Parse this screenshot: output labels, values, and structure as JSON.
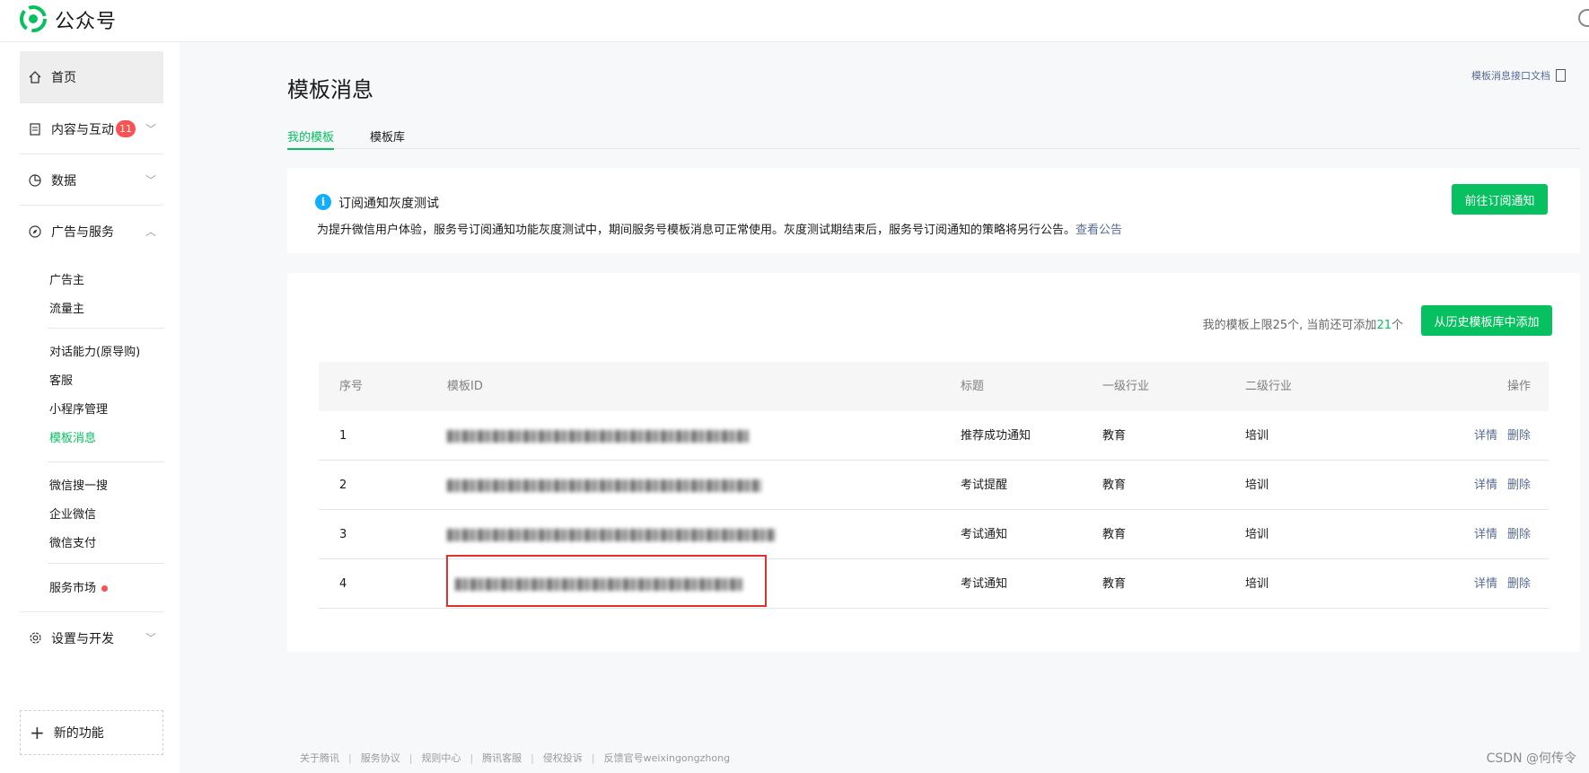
{
  "header": {
    "logo_text": "公众号",
    "logo_color": "#07c160"
  },
  "sidebar": {
    "home": "首页",
    "content": "内容与互动",
    "content_badge": "11",
    "data": "数据",
    "ads": "广告与服务",
    "ads_sub": [
      "广告主",
      "流量主"
    ],
    "capability_sub": [
      "对话能力(原导购)",
      "客服",
      "小程序管理",
      "模板消息"
    ],
    "wechat_sub": [
      "微信搜一搜",
      "企业微信",
      "微信支付"
    ],
    "market": "服务市场",
    "settings": "设置与开发",
    "new_feature": "新的功能"
  },
  "main": {
    "title": "模板消息",
    "doc_link": "模板消息接口文档",
    "tabs": [
      "我的模板",
      "模板库"
    ],
    "notice": {
      "title": "订阅通知灰度测试",
      "body": "为提升微信用户体验，服务号订阅通知功能灰度测试中，期间服务号模板消息可正常使用。灰度测试期结束后，服务号订阅通知的策略将另行公告。",
      "link": "查看公告",
      "button": "前往订阅通知"
    },
    "limit": {
      "prefix": "我的模板上限25个, 当前还可添加",
      "count": "21",
      "suffix": "个"
    },
    "add_button": "从历史模板库中添加",
    "table": {
      "headers": [
        "序号",
        "模板ID",
        "标题",
        "一级行业",
        "二级行业",
        "操作"
      ],
      "rows": [
        {
          "idx": "1",
          "title": "推荐成功通知",
          "ind1": "教育",
          "ind2": "培训"
        },
        {
          "idx": "2",
          "title": "考试提醒",
          "ind1": "教育",
          "ind2": "培训"
        },
        {
          "idx": "3",
          "title": "考试通知",
          "ind1": "教育",
          "ind2": "培训"
        },
        {
          "idx": "4",
          "title": "考试通知",
          "ind1": "教育",
          "ind2": "培训"
        }
      ],
      "op_detail": "详情",
      "op_delete": "删除"
    }
  },
  "footer": {
    "links": [
      "关于腾讯",
      "服务协议",
      "规则中心",
      "腾讯客服",
      "侵权投诉",
      "反馈官号weixingongzhong"
    ],
    "watermark": "CSDN @何传令"
  }
}
